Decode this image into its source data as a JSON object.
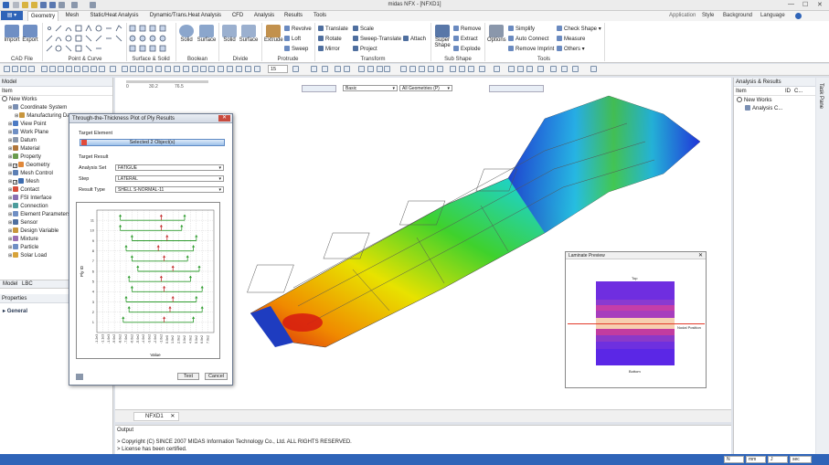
{
  "window": {
    "title": "midas NFX - [NFXD1]"
  },
  "menu": {
    "file": "",
    "tabs": [
      "Geometry",
      "Mesh",
      "Static/Heat Analysis",
      "Dynamic/Trans.Heat Analysis",
      "CFD",
      "Analysis",
      "Results",
      "Tools"
    ],
    "right": [
      "Application",
      "Style",
      "Background",
      "Language"
    ]
  },
  "ribbon": {
    "cad_file": {
      "group": "CAD File",
      "import": "Import",
      "export": "Export"
    },
    "point_curve": {
      "group": "Point & Curve"
    },
    "surface_solid": {
      "group": "Surface & Solid"
    },
    "boolean": {
      "group": "Boolean",
      "solid": "Solid",
      "surface": "Surface"
    },
    "divide": {
      "group": "Divide",
      "solid": "Solid",
      "surface": "Surface"
    },
    "protrude": {
      "group": "Protrude",
      "extrude": "Extrude",
      "revolve": "Revolve",
      "loft": "Loft",
      "sweep": "Sweep"
    },
    "transform": {
      "group": "Transform",
      "translate": "Translate",
      "rotate": "Rotate",
      "mirror": "Mirror",
      "scale": "Scale",
      "sweep_translate": "Sweep-Translate",
      "project": "Project",
      "attach": "Attach"
    },
    "sub_shape": {
      "group": "Sub Shape",
      "super_shape": "Super Shape",
      "remove": "Remove",
      "extract": "Extract",
      "explode": "Explode"
    },
    "tools": {
      "group": "Tools",
      "options": "Options",
      "simplify": "Simplify",
      "auto_connect": "Auto Connect",
      "remove_imprint": "Remove Imprint",
      "check_shape": "Check Shape",
      "measure": "Measure",
      "others": "Others"
    }
  },
  "toolbar": {
    "num": "15"
  },
  "view_toolbar": {
    "display": "Basic",
    "filter": "All Geometries (P)"
  },
  "scale": {
    "ticks": [
      "0",
      "30.2",
      "76.5"
    ]
  },
  "model_panel": {
    "title": "Model",
    "column": "Item",
    "tabs": [
      "Model",
      "LBC"
    ],
    "items": [
      {
        "label": "New Works",
        "level": 0
      },
      {
        "label": "Coordinate System",
        "level": 1
      },
      {
        "label": "Manufacturing Data",
        "level": 2
      },
      {
        "label": "View Point",
        "level": 1
      },
      {
        "label": "Work Plane",
        "level": 1
      },
      {
        "label": "Datum",
        "level": 1
      },
      {
        "label": "Material",
        "level": 1
      },
      {
        "label": "Property",
        "level": 1
      },
      {
        "label": "Geometry",
        "level": 1
      },
      {
        "label": "Mesh Control",
        "level": 1
      },
      {
        "label": "Mesh",
        "level": 1
      },
      {
        "label": "Contact",
        "level": 1
      },
      {
        "label": "FSI Interface",
        "level": 1
      },
      {
        "label": "Connection",
        "level": 1
      },
      {
        "label": "Element Parameters",
        "level": 1
      },
      {
        "label": "Sensor",
        "level": 1
      },
      {
        "label": "Design Variable",
        "level": 1
      },
      {
        "label": "Mixture",
        "level": 1
      },
      {
        "label": "Particle",
        "level": 1
      },
      {
        "label": "Solar Load",
        "level": 1
      }
    ]
  },
  "properties": {
    "title": "Properties",
    "section": "General"
  },
  "analysis_panel": {
    "title": "Analysis & Results",
    "col_item": "Item",
    "col_id": "ID",
    "col_c": "C...",
    "items": [
      "New Works",
      "Analysis C..."
    ]
  },
  "task_pane": {
    "label": "Task Pane"
  },
  "doc_tab": {
    "label": "NFXD1"
  },
  "output": {
    "title": "Output",
    "lines": [
      "> Copyright (C) SINCE 2007 MIDAS Information Technology Co., Ltd. ALL RIGHTS RESERVED.",
      "> License has been certified."
    ]
  },
  "status": {
    "units": [
      "N",
      "mm",
      "J",
      "sec"
    ]
  },
  "dialog": {
    "title": "Through-the-Thickness Plot of Ply Results",
    "target_element": "Target Element",
    "selected": "Selected 2 Object(s)",
    "target_result": "Target Result",
    "analysis_set_label": "Analysis Set",
    "analysis_set": "FATIGUE",
    "step_label": "Step",
    "step": "LATERAL",
    "result_type_label": "Result Type",
    "result_type": "SHELL S-NORMAL-11",
    "text_btn": "Text",
    "cancel_btn": "Cancel"
  },
  "chart_data": {
    "type": "line",
    "xlabel": "Value",
    "ylabel": "Ply ID",
    "xticks": [
      "-1.2e3",
      "-1.1e3",
      "-1.0e3",
      "-9.0e2",
      "-8.0e2",
      "-7.0e2",
      "-6.0e2",
      "-5.0e2",
      "-4.0e2",
      "-3.0e2",
      "-2.0e2",
      "-1.0e2",
      "0.0e0",
      "1.0e2",
      "2.0e2",
      "3.0e2",
      "4.0e2",
      "5.0e2",
      "6.0e2",
      "7.0e2"
    ],
    "yticks": [
      "1",
      "2",
      "3",
      "4",
      "5",
      "6",
      "7",
      "8",
      "9",
      "10",
      "11"
    ],
    "x_range": [
      -1200,
      800
    ],
    "y_range": [
      0,
      12
    ],
    "series": [
      {
        "color": "#2e9b2e",
        "points": [
          [
            -800,
            11
          ],
          [
            -800,
            10
          ],
          [
            -600,
            9
          ],
          [
            -700,
            8
          ],
          [
            -600,
            7
          ],
          [
            -500,
            6
          ],
          [
            -650,
            5
          ],
          [
            -600,
            4
          ],
          [
            -700,
            3
          ],
          [
            -650,
            2
          ],
          [
            -750,
            1
          ]
        ]
      },
      {
        "color": "#c43030",
        "points": [
          [
            -100,
            11
          ],
          [
            -100,
            10
          ],
          [
            0,
            9
          ],
          [
            -150,
            8
          ],
          [
            -50,
            7
          ],
          [
            100,
            6
          ],
          [
            -100,
            5
          ],
          [
            -50,
            4
          ],
          [
            100,
            3
          ],
          [
            50,
            2
          ],
          [
            -50,
            1
          ]
        ]
      },
      {
        "color": "#2e9b2e",
        "points": [
          [
            300,
            11
          ],
          [
            250,
            10
          ],
          [
            500,
            9
          ],
          [
            450,
            8
          ],
          [
            350,
            7
          ],
          [
            550,
            6
          ],
          [
            400,
            5
          ],
          [
            600,
            4
          ],
          [
            500,
            3
          ],
          [
            600,
            2
          ],
          [
            450,
            1
          ]
        ]
      }
    ]
  },
  "laminate": {
    "title": "Laminate Preview",
    "top": "Top",
    "bottom": "Bottom",
    "nodal": "Nodal Position"
  },
  "colors": {
    "accent": "#2f64b8"
  }
}
